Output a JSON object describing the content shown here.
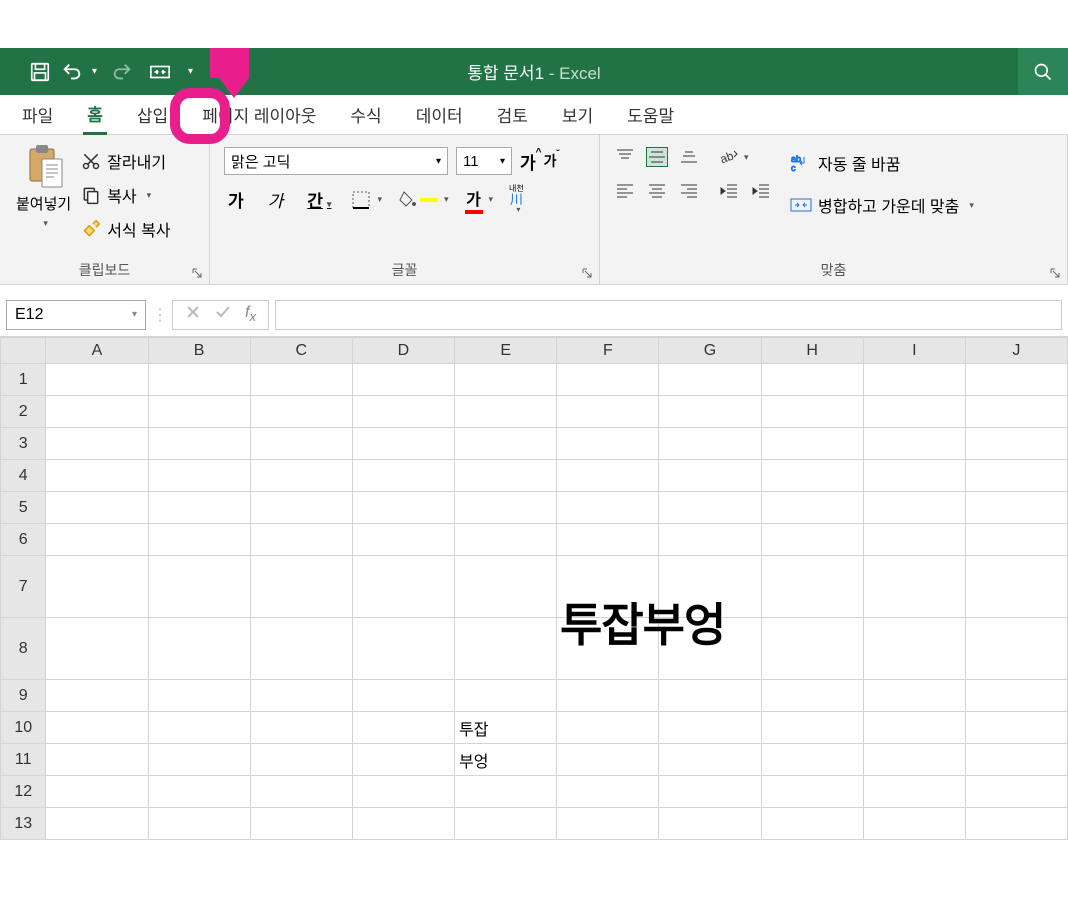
{
  "title": {
    "doc": "통합 문서1",
    "sep": " - ",
    "app": "Excel"
  },
  "ribbonTabs": [
    "파일",
    "홈",
    "삽입",
    "페이지 레이아웃",
    "수식",
    "데이터",
    "검토",
    "보기",
    "도움말"
  ],
  "activeTab": 1,
  "clipboard": {
    "groupLabel": "클립보드",
    "paste": "붙여넣기",
    "cut": "잘라내기",
    "copy": "복사",
    "formatPainter": "서식 복사"
  },
  "font": {
    "groupLabel": "글꼴",
    "name": "맑은 고딕",
    "size": "11",
    "bold": "가",
    "italic": "가",
    "underline": "간",
    "grow": "가",
    "shrink": "가",
    "fontColor": "가",
    "phoneticTop": "내천",
    "phoneticBottom": "川"
  },
  "alignment": {
    "groupLabel": "맞춤",
    "wrap": "자동 줄 바꿈",
    "merge": "병합하고 가운데 맞춤"
  },
  "nameBox": "E12",
  "formula": "",
  "columns": [
    "A",
    "B",
    "C",
    "D",
    "E",
    "F",
    "G",
    "H",
    "I",
    "J"
  ],
  "rows": [
    1,
    2,
    3,
    4,
    5,
    6,
    7,
    8,
    9,
    10,
    11,
    12,
    13
  ],
  "tallRows": [
    7,
    8
  ],
  "cells": {
    "E10": "투잡",
    "E11": "부엉"
  },
  "watermark": "투잡부엉"
}
